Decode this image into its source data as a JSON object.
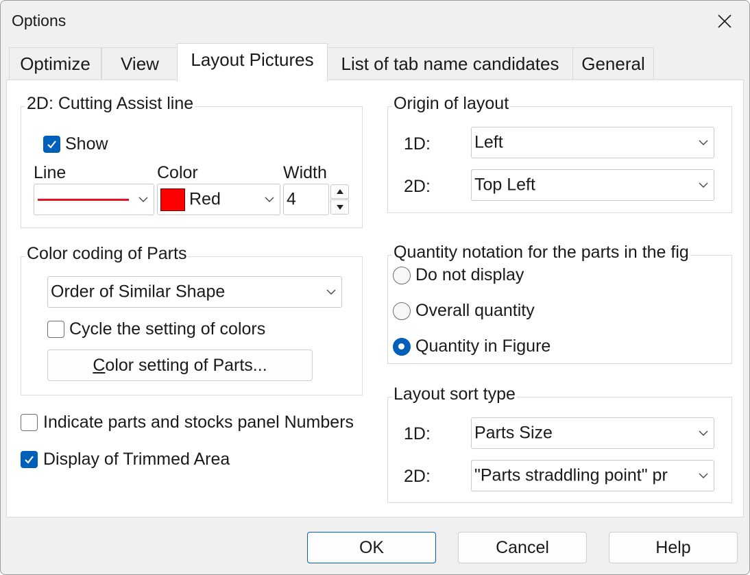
{
  "window": {
    "title": "Options"
  },
  "tabs": [
    "Optimize",
    "View",
    "Layout Pictures",
    "List of tab name candidates",
    "General"
  ],
  "cutting_assist": {
    "group_label": "2D: Cutting Assist line",
    "show_label": "Show",
    "show_checked": true,
    "line_label": "Line",
    "color_label": "Color",
    "width_label": "Width",
    "color_value": "Red",
    "color_swatch": "#ff0000",
    "line_color": "#e81123",
    "width_value": "4"
  },
  "color_coding": {
    "group_label": "Color coding of Parts",
    "selected": "Order of Similar Shape",
    "cycle_label": "Cycle the setting of colors",
    "cycle_checked": false,
    "button_first": "C",
    "button_rest": "olor setting of Parts..."
  },
  "indicate_numbers": {
    "label": "Indicate parts and stocks panel Numbers",
    "checked": false
  },
  "trimmed_area": {
    "label": "Display of Trimmed Area",
    "checked": true
  },
  "origin": {
    "group_label": "Origin of layout",
    "d1_label": "1D:",
    "d1_value": "Left",
    "d2_label": "2D:",
    "d2_value": "Top Left"
  },
  "quantity": {
    "group_label": "Quantity notation for the parts in the fig",
    "options": [
      "Do not display",
      "Overall quantity",
      "Quantity in Figure"
    ],
    "selected_index": 2
  },
  "sort": {
    "group_label": "Layout sort type",
    "d1_label": "1D:",
    "d1_value": "Parts Size",
    "d2_label": "2D:",
    "d2_value": "\"Parts straddling point\" pr"
  },
  "buttons": {
    "ok": "OK",
    "cancel": "Cancel",
    "help": "Help"
  },
  "colors": {
    "accent": "#005fb8"
  }
}
